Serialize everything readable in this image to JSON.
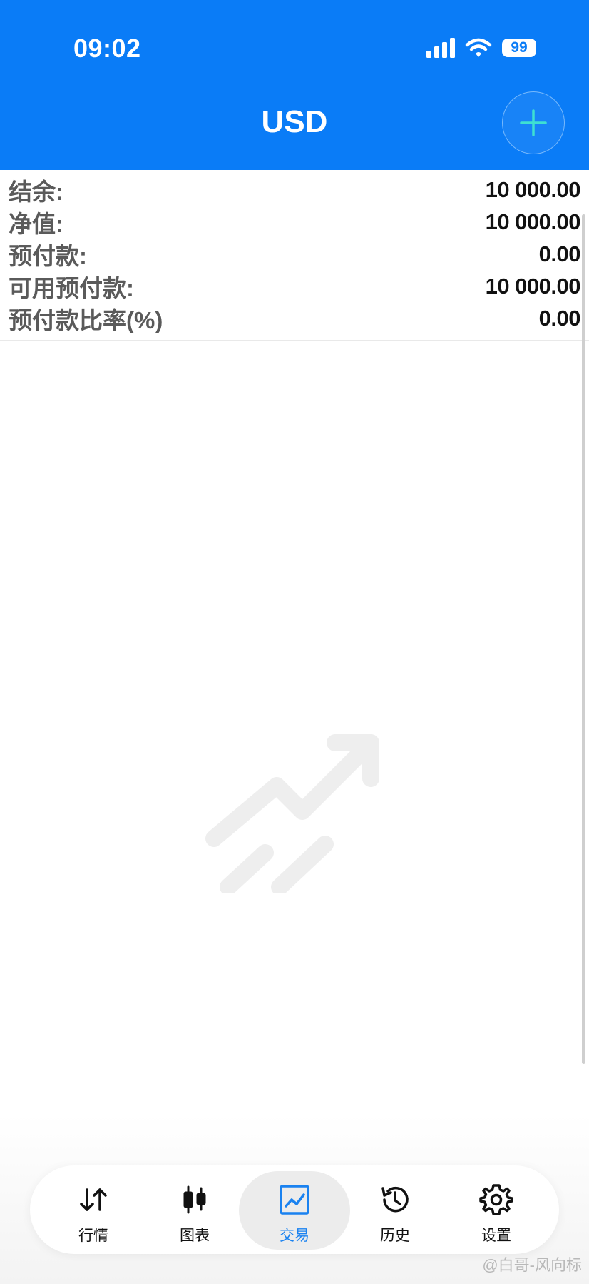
{
  "status_bar": {
    "time": "09:02",
    "battery": "99"
  },
  "header": {
    "title": "USD",
    "add_icon": "plus-icon"
  },
  "account": {
    "rows": [
      {
        "label": "结余:",
        "value": "10 000.00"
      },
      {
        "label": "净值:",
        "value": "10 000.00"
      },
      {
        "label": "预付款:",
        "value": "0.00"
      },
      {
        "label": "可用预付款:",
        "value": "10 000.00"
      },
      {
        "label": "预付款比率(%)",
        "value": "0.00"
      }
    ]
  },
  "empty_state": {
    "icon": "trend-up-arrow-icon"
  },
  "nav": {
    "items": [
      {
        "label": "行情",
        "icon": "quotes-arrows-icon"
      },
      {
        "label": "图表",
        "icon": "candlestick-icon"
      },
      {
        "label": "交易",
        "icon": "trade-chart-icon",
        "active": true
      },
      {
        "label": "历史",
        "icon": "history-clock-icon"
      },
      {
        "label": "设置",
        "icon": "gear-icon"
      }
    ]
  },
  "colors": {
    "header_bg": "#0a7cf7",
    "active": "#1a82f0",
    "add_plus": "#3ee0d2"
  },
  "watermark": "@白哥-风向标"
}
